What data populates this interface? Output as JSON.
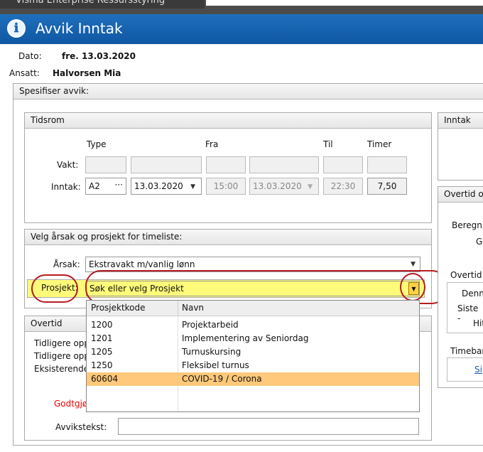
{
  "app": {
    "window_title": "Visma Enterprise Ressursstyring"
  },
  "dialog": {
    "title": "Avvik Inntak",
    "info_icon": "ℹ"
  },
  "header": {
    "dato_label": "Dato:",
    "dato_value": "fre. 13.03.2020",
    "ansatt_label": "Ansatt:",
    "ansatt_value": "Halvorsen Mia"
  },
  "spesifiser": {
    "label": "Spesifiser avvik:"
  },
  "tidsrom": {
    "title": "Tidsrom",
    "col_type": "Type",
    "col_fra": "Fra",
    "col_til": "Til",
    "col_timer": "Timer",
    "vakt_label": "Vakt:",
    "inntak_label": "Inntak:",
    "inntak_type": "A2",
    "inntak_type_btn": "···",
    "inntak_fra_date": "13.03.2020",
    "inntak_fra_time": "15:00",
    "inntak_til_date": "13.03.2020",
    "inntak_til_time": "22:30",
    "inntak_timer": "7,50"
  },
  "aarsak_panel": {
    "title": "Velg årsak og prosjekt for timeliste:",
    "aarsak_label": "Årsak:",
    "aarsak_value": "Ekstravakt m/vanlig lønn",
    "prosjekt_label": "Prosjekt:",
    "prosjekt_placeholder": "Søk eller velg Prosjekt"
  },
  "prosjekt_dropdown": {
    "col_code": "Prosjektkode",
    "col_name": "Navn",
    "rows": [
      {
        "code": "1200",
        "name": "Projektarbeid"
      },
      {
        "code": "1201",
        "name": "Implementering av Seniordag"
      },
      {
        "code": "1205",
        "name": "Turnuskursing"
      },
      {
        "code": "1250",
        "name": "Fleksibel turnus"
      },
      {
        "code": "60604",
        "name": "COVID-19 / Corona"
      }
    ],
    "selected_index": 4
  },
  "overtid_panel": {
    "title": "Overtid",
    "line1": "Tidligere opp",
    "line2": "Tidligere opp",
    "line3": "Eksisterende",
    "godtgj": "Godtgjø",
    "avvikstekst_label": "Avvikstekst:"
  },
  "right_panels": {
    "inntak_title": "Inntak",
    "overtid_title": "Overtid o",
    "beregn": "Beregn",
    "g": "G",
    "overtid_label": "Overtid",
    "denn": "Denn",
    "siste": "Siste -",
    "hit": "Hit",
    "timebank": "Timeban",
    "s_link": "Si"
  },
  "colors": {
    "title_bg": "#1565b5",
    "highlight": "#fffb7a",
    "selected_row": "#ffc87a",
    "ring": "#b81b22"
  }
}
